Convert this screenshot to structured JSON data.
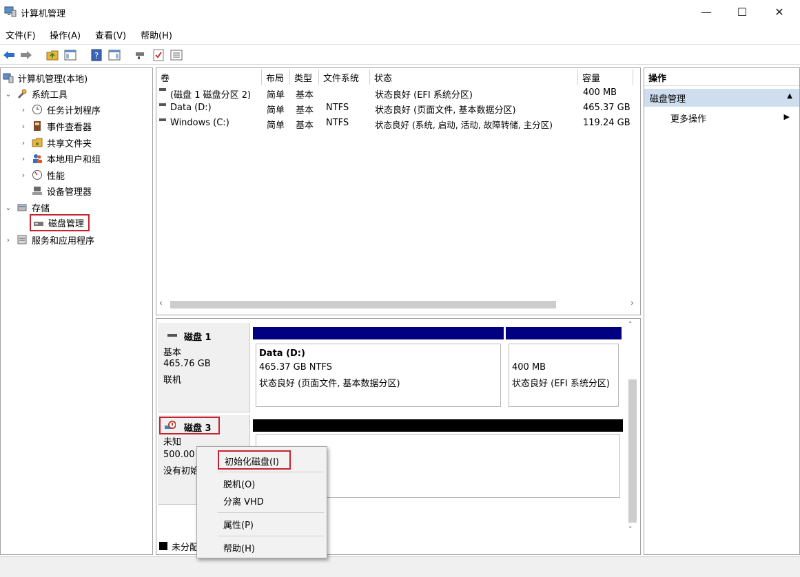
{
  "window": {
    "title": "计算机管理",
    "controls": {
      "minimize": "—",
      "maximize": "☐",
      "close": "✕"
    }
  },
  "menu": {
    "items": [
      "文件(F)",
      "操作(A)",
      "查看(V)",
      "帮助(H)"
    ]
  },
  "tree": {
    "root": "计算机管理(本地)",
    "system_tools": "系统工具",
    "task_scheduler": "任务计划程序",
    "event_viewer": "事件查看器",
    "shared_folders": "共享文件夹",
    "local_users": "本地用户和组",
    "performance": "性能",
    "device_manager": "设备管理器",
    "storage": "存储",
    "disk_management": "磁盘管理",
    "services_apps": "服务和应用程序"
  },
  "volumes": {
    "headers": [
      "卷",
      "布局",
      "类型",
      "文件系统",
      "状态",
      "容量"
    ],
    "rows": [
      {
        "name": "(磁盘 1 磁盘分区 2)",
        "layout": "简单",
        "type": "基本",
        "fs": "",
        "status": "状态良好 (EFI 系统分区)",
        "capacity": "400 MB"
      },
      {
        "name": "Data (D:)",
        "layout": "简单",
        "type": "基本",
        "fs": "NTFS",
        "status": "状态良好 (页面文件, 基本数据分区)",
        "capacity": "465.37 GB"
      },
      {
        "name": "Windows (C:)",
        "layout": "简单",
        "type": "基本",
        "fs": "NTFS",
        "status": "状态良好 (系统, 启动, 活动, 故障转储, 主分区)",
        "capacity": "119.24 GB"
      }
    ]
  },
  "disks": {
    "disk1": {
      "name": "磁盘 1",
      "type": "基本",
      "size": "465.76 GB",
      "state": "联机",
      "part1_title": "Data  (D:)",
      "part1_size": "465.37 GB NTFS",
      "part1_status": "状态良好 (页面文件, 基本数据分区)",
      "part2_size": "400 MB",
      "part2_status": "状态良好 (EFI 系统分区)"
    },
    "disk3": {
      "name": "磁盘 3",
      "type": "未知",
      "size": "500.00",
      "state": "没有初始"
    },
    "legend_unallocated": "未分配"
  },
  "actions": {
    "title": "操作",
    "section": "磁盘管理",
    "more": "更多操作"
  },
  "context_menu": {
    "initialize": "初始化磁盘(I)",
    "offline": "脱机(O)",
    "detach": "分离 VHD",
    "properties": "属性(P)",
    "help": "帮助(H)"
  },
  "colors": {
    "primary_partition": "#000080",
    "unallocated": "#000000",
    "highlight": "#c4232f",
    "selected_section": "#cfdeef"
  }
}
